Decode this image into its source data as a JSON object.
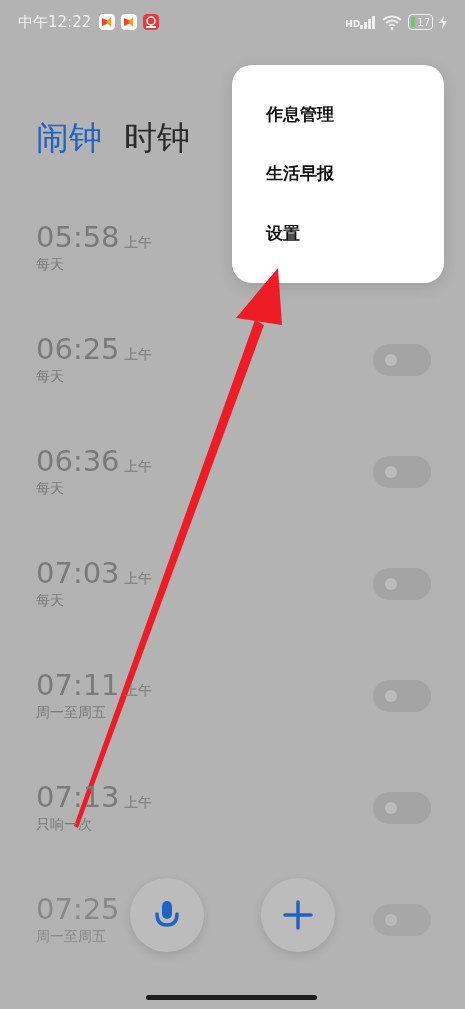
{
  "status_bar": {
    "time": "中午12:22",
    "signal_label": "HD",
    "battery": "17"
  },
  "tabs": [
    {
      "label": "闹钟",
      "selected": true
    },
    {
      "label": "时钟",
      "selected": false
    }
  ],
  "alarms": [
    {
      "time": "05:58",
      "period": "上午",
      "repeat": "每天"
    },
    {
      "time": "06:25",
      "period": "上午",
      "repeat": "每天",
      "on": false
    },
    {
      "time": "06:36",
      "period": "上午",
      "repeat": "每天",
      "on": false
    },
    {
      "time": "07:03",
      "period": "上午",
      "repeat": "每天",
      "on": false
    },
    {
      "time": "07:11",
      "period": "上午",
      "repeat": "周一至周五",
      "on": false
    },
    {
      "time": "07:13",
      "period": "上午",
      "repeat": "只响一次",
      "on": false
    },
    {
      "time": "07:25",
      "repeat": "周一至周五",
      "on": false
    }
  ],
  "menu": {
    "items": [
      "作息管理",
      "生活早报",
      "设置"
    ]
  }
}
